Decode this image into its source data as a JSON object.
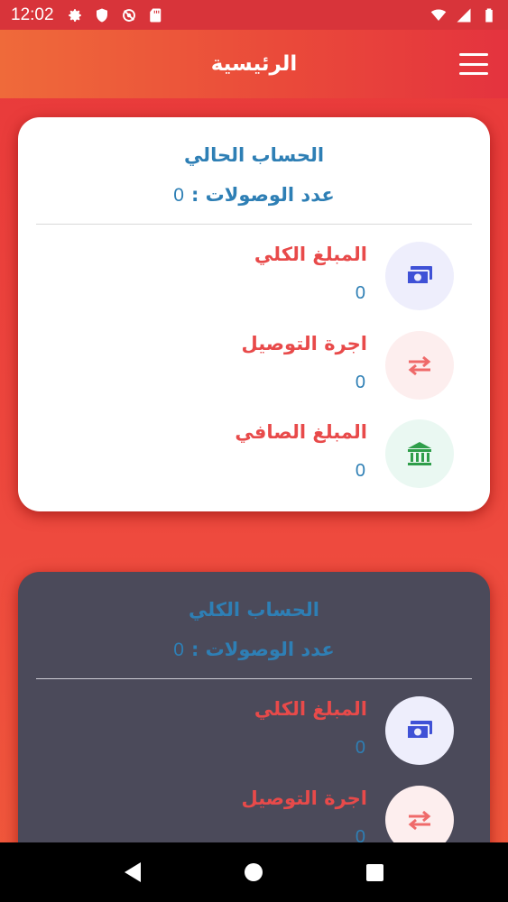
{
  "status_bar": {
    "time": "12:02",
    "left_icons": [
      "gear-icon",
      "shield-icon",
      "no-sync-icon",
      "sd-card-icon"
    ],
    "right_icons": [
      "wifi-icon",
      "signal-icon",
      "battery-icon"
    ]
  },
  "app_bar": {
    "title": "الرئيسية",
    "menu_icon": "hamburger-menu-icon"
  },
  "current_account": {
    "title": "الحساب الحالي",
    "receipts_label": "عدد الوصولات :",
    "receipts_count": "0",
    "items": [
      {
        "label": "المبلغ الكلي",
        "value": "0",
        "icon": "money-icon",
        "icon_bg": "#eeeefc",
        "icon_color": "#3f51d6"
      },
      {
        "label": "اجرة التوصيل",
        "value": "0",
        "icon": "swap-arrows-icon",
        "icon_bg": "#fdeeee",
        "icon_color": "#ef6a6a"
      },
      {
        "label": "المبلغ الصافي",
        "value": "0",
        "icon": "bank-icon",
        "icon_bg": "#eaf8f2",
        "icon_color": "#2e9e4a"
      }
    ]
  },
  "total_account": {
    "title": "الحساب الكلي",
    "receipts_label": "عدد الوصولات :",
    "receipts_count": "0",
    "items": [
      {
        "label": "المبلغ الكلي",
        "value": "0",
        "icon": "money-icon",
        "icon_bg": "#eeeefc",
        "icon_color": "#3f51d6"
      },
      {
        "label": "اجرة التوصيل",
        "value": "0",
        "icon": "swap-arrows-icon",
        "icon_bg": "#fdeeee",
        "icon_color": "#ef6a6a"
      }
    ]
  },
  "nav_bar": {
    "icons": [
      "back-icon",
      "home-icon",
      "recents-icon"
    ]
  }
}
